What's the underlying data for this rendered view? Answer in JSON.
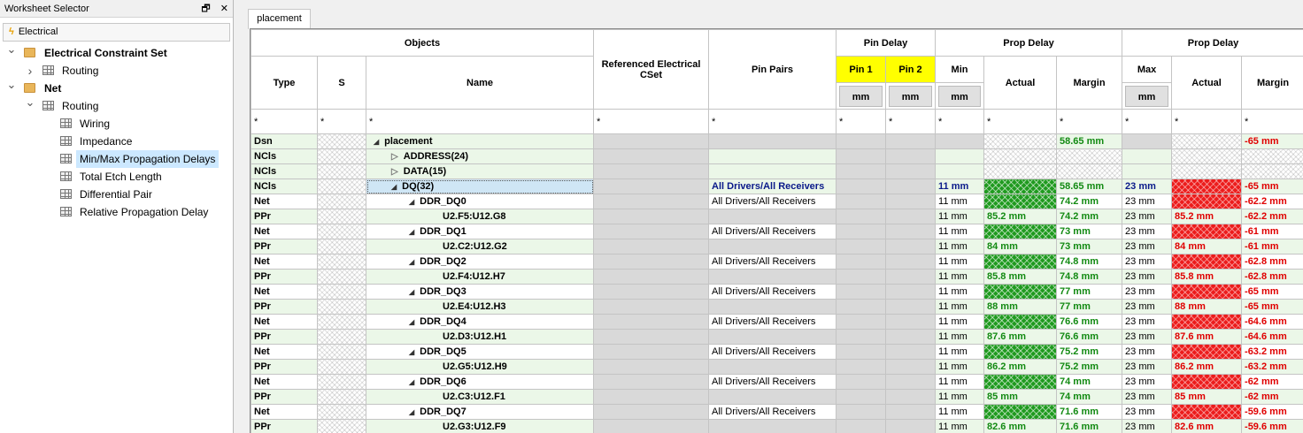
{
  "panel": {
    "title": "Worksheet Selector",
    "pin_glyph": "🗗",
    "close_glyph": "✕",
    "electrical_tab": "Electrical",
    "tree": [
      {
        "label": "Electrical Constraint Set",
        "level": 0,
        "icon": "folder",
        "expander": "down",
        "bold": true
      },
      {
        "label": "Routing",
        "level": 1,
        "icon": "grid",
        "expander": "right"
      },
      {
        "label": "Net",
        "level": 0,
        "icon": "folder",
        "expander": "down",
        "bold": true
      },
      {
        "label": "Routing",
        "level": 1,
        "icon": "grid",
        "expander": "down"
      },
      {
        "label": "Wiring",
        "level": 2,
        "icon": "grid"
      },
      {
        "label": "Impedance",
        "level": 2,
        "icon": "grid"
      },
      {
        "label": "Min/Max Propagation Delays",
        "level": 2,
        "icon": "grid",
        "selected": true
      },
      {
        "label": "Total Etch Length",
        "level": 2,
        "icon": "grid"
      },
      {
        "label": "Differential Pair",
        "level": 2,
        "icon": "grid"
      },
      {
        "label": "Relative Propagation Delay",
        "level": 2,
        "icon": "grid"
      }
    ]
  },
  "sheet": {
    "tab": "placement",
    "headers": {
      "objects": "Objects",
      "ref_cset": "Referenced Electrical CSet",
      "pin_pairs": "Pin Pairs",
      "pin_delay": "Pin Delay",
      "prop_delay_min": "Prop Delay",
      "prop_delay_max": "Prop Delay",
      "type": "Type",
      "s": "S",
      "name": "Name",
      "pin1": "Pin 1",
      "pin2": "Pin 2",
      "min": "Min",
      "actual": "Actual",
      "margin": "Margin",
      "max": "Max",
      "actual2": "Actual",
      "margin2": "Margin",
      "unit": "mm",
      "filter": "*"
    },
    "rows": [
      {
        "type": "Dsn",
        "name": "placement",
        "indent": 0,
        "tri": "open",
        "pinpairs": "",
        "min": "",
        "actual": "",
        "margin": "58.65 mm",
        "max": "",
        "actual2": "",
        "margin2": "-65 mm",
        "style": "dsn"
      },
      {
        "type": "NCls",
        "name": "ADDRESS(24)",
        "indent": 1,
        "tri": "closed",
        "pinpairs": "",
        "min": "",
        "actual": "",
        "margin": "",
        "max": "",
        "actual2": "",
        "margin2": "",
        "style": "ncls"
      },
      {
        "type": "NCls",
        "name": "DATA(15)",
        "indent": 1,
        "tri": "closed",
        "pinpairs": "",
        "min": "",
        "actual": "",
        "margin": "",
        "max": "",
        "actual2": "",
        "margin2": "",
        "style": "ncls"
      },
      {
        "type": "NCls",
        "name": "DQ(32)",
        "indent": 1,
        "tri": "open",
        "pinpairs": "All Drivers/All Receivers",
        "min": "11 mm",
        "actual": "",
        "margin": "58.65 mm",
        "max": "23 mm",
        "actual2": "",
        "margin2": "-65 mm",
        "style": "dq"
      },
      {
        "type": "Net",
        "name": "DDR_DQ0",
        "indent": 2,
        "tri": "open",
        "pinpairs": "All Drivers/All Receivers",
        "min": "11 mm",
        "actual": "",
        "margin": "74.2 mm",
        "max": "23 mm",
        "actual2": "",
        "margin2": "-62.2 mm",
        "style": "net"
      },
      {
        "type": "PPr",
        "name": "U2.F5:U12.G8",
        "indent": 3,
        "pinpairs": "",
        "min": "11 mm",
        "actual": "85.2 mm",
        "margin": "74.2 mm",
        "max": "23 mm",
        "actual2": "85.2 mm",
        "margin2": "-62.2 mm",
        "style": "ppr"
      },
      {
        "type": "Net",
        "name": "DDR_DQ1",
        "indent": 2,
        "tri": "open",
        "pinpairs": "All Drivers/All Receivers",
        "min": "11 mm",
        "actual": "",
        "margin": "73 mm",
        "max": "23 mm",
        "actual2": "",
        "margin2": "-61 mm",
        "style": "net"
      },
      {
        "type": "PPr",
        "name": "U2.C2:U12.G2",
        "indent": 3,
        "pinpairs": "",
        "min": "11 mm",
        "actual": "84 mm",
        "margin": "73 mm",
        "max": "23 mm",
        "actual2": "84 mm",
        "margin2": "-61 mm",
        "style": "ppr"
      },
      {
        "type": "Net",
        "name": "DDR_DQ2",
        "indent": 2,
        "tri": "open",
        "pinpairs": "All Drivers/All Receivers",
        "min": "11 mm",
        "actual": "",
        "margin": "74.8 mm",
        "max": "23 mm",
        "actual2": "",
        "margin2": "-62.8 mm",
        "style": "net"
      },
      {
        "type": "PPr",
        "name": "U2.F4:U12.H7",
        "indent": 3,
        "pinpairs": "",
        "min": "11 mm",
        "actual": "85.8 mm",
        "margin": "74.8 mm",
        "max": "23 mm",
        "actual2": "85.8 mm",
        "margin2": "-62.8 mm",
        "style": "ppr"
      },
      {
        "type": "Net",
        "name": "DDR_DQ3",
        "indent": 2,
        "tri": "open",
        "pinpairs": "All Drivers/All Receivers",
        "min": "11 mm",
        "actual": "",
        "margin": "77 mm",
        "max": "23 mm",
        "actual2": "",
        "margin2": "-65 mm",
        "style": "net"
      },
      {
        "type": "PPr",
        "name": "U2.E4:U12.H3",
        "indent": 3,
        "pinpairs": "",
        "min": "11 mm",
        "actual": "88 mm",
        "margin": "77 mm",
        "max": "23 mm",
        "actual2": "88 mm",
        "margin2": "-65 mm",
        "style": "ppr"
      },
      {
        "type": "Net",
        "name": "DDR_DQ4",
        "indent": 2,
        "tri": "open",
        "pinpairs": "All Drivers/All Receivers",
        "min": "11 mm",
        "actual": "",
        "margin": "76.6 mm",
        "max": "23 mm",
        "actual2": "",
        "margin2": "-64.6 mm",
        "style": "net"
      },
      {
        "type": "PPr",
        "name": "U2.D3:U12.H1",
        "indent": 3,
        "pinpairs": "",
        "min": "11 mm",
        "actual": "87.6 mm",
        "margin": "76.6 mm",
        "max": "23 mm",
        "actual2": "87.6 mm",
        "margin2": "-64.6 mm",
        "style": "ppr"
      },
      {
        "type": "Net",
        "name": "DDR_DQ5",
        "indent": 2,
        "tri": "open",
        "pinpairs": "All Drivers/All Receivers",
        "min": "11 mm",
        "actual": "",
        "margin": "75.2 mm",
        "max": "23 mm",
        "actual2": "",
        "margin2": "-63.2 mm",
        "style": "net"
      },
      {
        "type": "PPr",
        "name": "U2.G5:U12.H9",
        "indent": 3,
        "pinpairs": "",
        "min": "11 mm",
        "actual": "86.2 mm",
        "margin": "75.2 mm",
        "max": "23 mm",
        "actual2": "86.2 mm",
        "margin2": "-63.2 mm",
        "style": "ppr"
      },
      {
        "type": "Net",
        "name": "DDR_DQ6",
        "indent": 2,
        "tri": "open",
        "pinpairs": "All Drivers/All Receivers",
        "min": "11 mm",
        "actual": "",
        "margin": "74 mm",
        "max": "23 mm",
        "actual2": "",
        "margin2": "-62 mm",
        "style": "net"
      },
      {
        "type": "PPr",
        "name": "U2.C3:U12.F1",
        "indent": 3,
        "pinpairs": "",
        "min": "11 mm",
        "actual": "85 mm",
        "margin": "74 mm",
        "max": "23 mm",
        "actual2": "85 mm",
        "margin2": "-62 mm",
        "style": "ppr"
      },
      {
        "type": "Net",
        "name": "DDR_DQ7",
        "indent": 2,
        "tri": "open",
        "pinpairs": "All Drivers/All Receivers",
        "min": "11 mm",
        "actual": "",
        "margin": "71.6 mm",
        "max": "23 mm",
        "actual2": "",
        "margin2": "-59.6 mm",
        "style": "net"
      },
      {
        "type": "PPr",
        "name": "U2.G3:U12.F9",
        "indent": 3,
        "pinpairs": "",
        "min": "11 mm",
        "actual": "82.6 mm",
        "margin": "71.6 mm",
        "max": "23 mm",
        "actual2": "82.6 mm",
        "margin2": "-59.6 mm",
        "style": "ppr"
      }
    ]
  }
}
